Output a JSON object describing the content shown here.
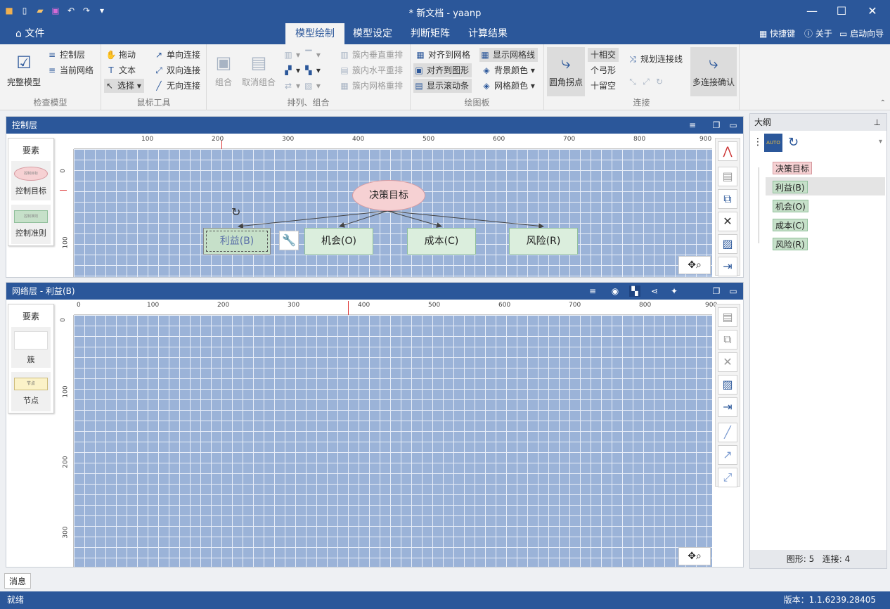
{
  "window": {
    "title": "* 新文档 - yaanp"
  },
  "menu": {
    "file": "文件",
    "tabs": [
      "模型绘制",
      "模型设定",
      "判断矩阵",
      "计算结果"
    ],
    "shortcuts": "快捷键",
    "about": "关于",
    "guide": "启动向导"
  },
  "ribbon": {
    "check": {
      "full_model": "完整模型",
      "control_layer": "控制层",
      "current_network": "当前网络",
      "label": "检查模型"
    },
    "mouse": {
      "drag": "拖动",
      "text": "文本",
      "select": "选择",
      "one_way": "单向连接",
      "two_way": "双向连接",
      "no_dir": "无向连接",
      "label": "鼠标工具"
    },
    "arrange": {
      "group": "组合",
      "ungroup": "取消组合",
      "cluster_v": "簇内垂直重排",
      "cluster_h": "簇内水平重排",
      "cluster_grid": "簇内网格重排",
      "label": "排列、组合"
    },
    "canvas": {
      "align_grid": "对齐到网格",
      "align_shape": "对齐到图形",
      "show_scroll": "显示滚动条",
      "show_grid": "显示网格线",
      "bg_color": "背景颜色",
      "grid_color": "网格颜色",
      "label": "绘图板"
    },
    "connect": {
      "round_corner": "圆角拐点",
      "intersect": "相交",
      "arc": "弓形",
      "gap": "留空",
      "plan_lines": "规划连接线",
      "multi_confirm": "多连接确认",
      "label": "连接"
    }
  },
  "control_panel": {
    "title": "控制层",
    "palette_title": "要素",
    "palette_items": [
      "控制目标",
      "控制准则"
    ],
    "palette_item_texts": [
      "控制目标",
      "控制准则"
    ],
    "ruler_x": [
      "100",
      "200",
      "300",
      "400",
      "500",
      "600",
      "700",
      "800",
      "900"
    ],
    "ruler_y": [
      "0",
      "100"
    ],
    "goal_node": "决策目标",
    "nodes": [
      "利益(B)",
      "机会(O)",
      "成本(C)",
      "风险(R)"
    ]
  },
  "network_panel": {
    "title": "网络层 - 利益(B)",
    "palette_title": "要素",
    "palette_items": [
      "簇",
      "节点"
    ],
    "node_sample_text": "节点",
    "ruler_x": [
      "0",
      "100",
      "200",
      "300",
      "400",
      "500",
      "600",
      "700",
      "800",
      "900"
    ],
    "ruler_y": [
      "0",
      "100",
      "200",
      "300"
    ]
  },
  "outline": {
    "title": "大纲",
    "auto_label": "AUTO",
    "items": [
      "决策目标",
      "利益(B)",
      "机会(O)",
      "成本(C)",
      "风险(R)"
    ],
    "stats": "图形: 5   连接: 4"
  },
  "messages_tab": "消息",
  "status": {
    "left": "就绪",
    "right": "版本：1.1.6239.28405"
  }
}
